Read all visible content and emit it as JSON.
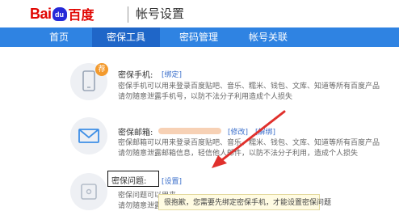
{
  "header": {
    "logo_latin": "Bai",
    "logo_paw_text": "du",
    "logo_cn": "百度",
    "title": "帐号设置"
  },
  "nav": {
    "items": [
      {
        "label": "首页"
      },
      {
        "label": "密保工具"
      },
      {
        "label": "密码管理"
      },
      {
        "label": "帐号关联"
      }
    ],
    "active_index": 1
  },
  "security_items": [
    {
      "icon": "phone-icon",
      "badge": "荐",
      "title": "密保手机:",
      "action": "[绑定]",
      "desc": [
        "密保手机可以用来登录百度贴吧、音乐、糯米、钱包、文库、知道等所有百度产品",
        "请勿随意泄露手机号，以防不法分子利用造成个人损失"
      ]
    },
    {
      "icon": "mail-icon",
      "title": "密保邮箱:",
      "action": "[修改]",
      "action2": "[解绑]",
      "desc": [
        "密保邮箱可以用来登录百度贴吧、音乐、糯米、钱包、文库、知道等所有百度产品",
        "请勿随意泄露邮箱信息，轻信他人邮件，以防不法分子利用，造成个人损失"
      ]
    },
    {
      "icon": "lock-icon",
      "title": "密保问题:",
      "action": "[设置]",
      "desc": [
        "密保问题可以用来",
        "请勿随意泄露"
      ]
    }
  ],
  "tooltip": "很抱歉，您需要先绑定密保手机，才能设置密保问题",
  "colors": {
    "nav_bg": "#2f83e2",
    "nav_active": "#1f66c8",
    "logo_red": "#e10602",
    "logo_blue": "#2529d8",
    "badge": "#f39a2d",
    "arrow": "#e0302c"
  }
}
